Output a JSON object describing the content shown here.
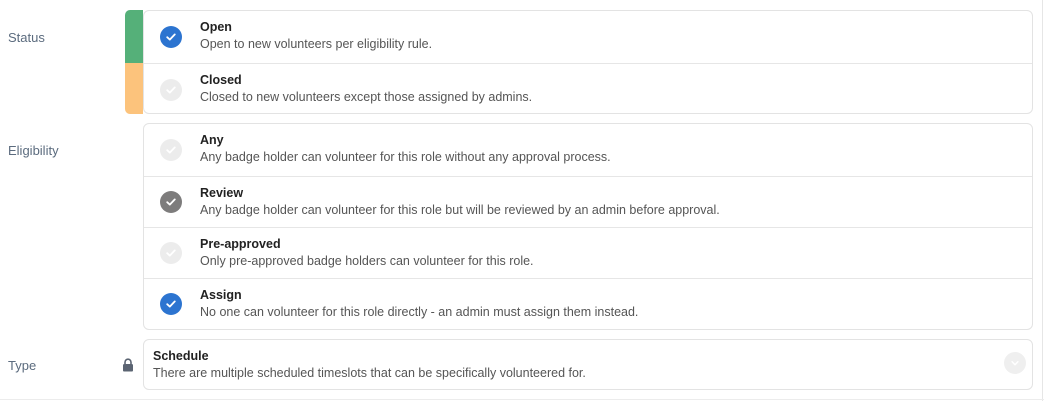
{
  "status": {
    "label": "Status",
    "options": [
      {
        "title": "Open",
        "description": "Open to new volunteers per eligibility rule.",
        "selected": true
      },
      {
        "title": "Closed",
        "description": "Closed to new volunteers except those assigned by admins.",
        "selected": false
      }
    ],
    "colors": {
      "open": "#55b079",
      "closed": "#fcc37c"
    }
  },
  "eligibility": {
    "label": "Eligibility",
    "options": [
      {
        "title": "Any",
        "description": "Any badge holder can volunteer for this role without any approval process.",
        "state": "unchecked"
      },
      {
        "title": "Review",
        "description": "Any badge holder can volunteer for this role but will be reviewed by an admin before approval.",
        "state": "checked-gray"
      },
      {
        "title": "Pre-approved",
        "description": "Only pre-approved badge holders can volunteer for this role.",
        "state": "unchecked"
      },
      {
        "title": "Assign",
        "description": "No one can volunteer for this role directly - an admin must assign them instead.",
        "state": "checked"
      }
    ]
  },
  "type": {
    "label": "Type",
    "locked_icon": "lock-icon",
    "selected_title": "Schedule",
    "selected_description": "There are multiple scheduled timeslots that can be specifically volunteered for."
  },
  "accent": "#2c74d0"
}
